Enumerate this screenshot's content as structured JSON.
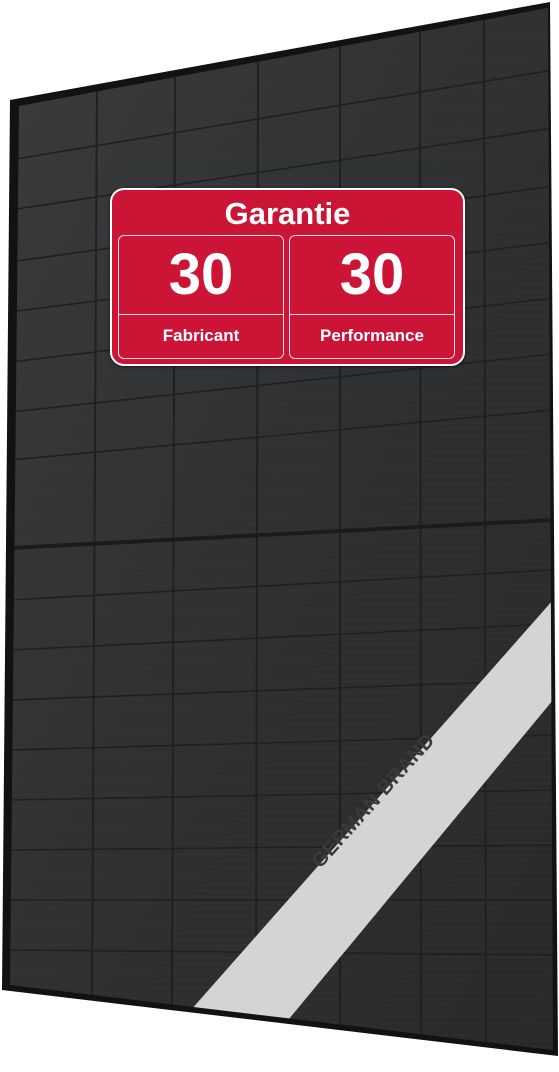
{
  "badge": {
    "title": "Garantie",
    "manufacturer": {
      "years": "30",
      "label": "Fabricant"
    },
    "performance": {
      "years": "30",
      "label": "Performance"
    }
  },
  "ribbon": {
    "text": "GERMAN BRAND"
  },
  "colors": {
    "badge_red": "#cc1437",
    "panel_dark": "#2e2f31",
    "ribbon_light": "#d4d4d4"
  }
}
